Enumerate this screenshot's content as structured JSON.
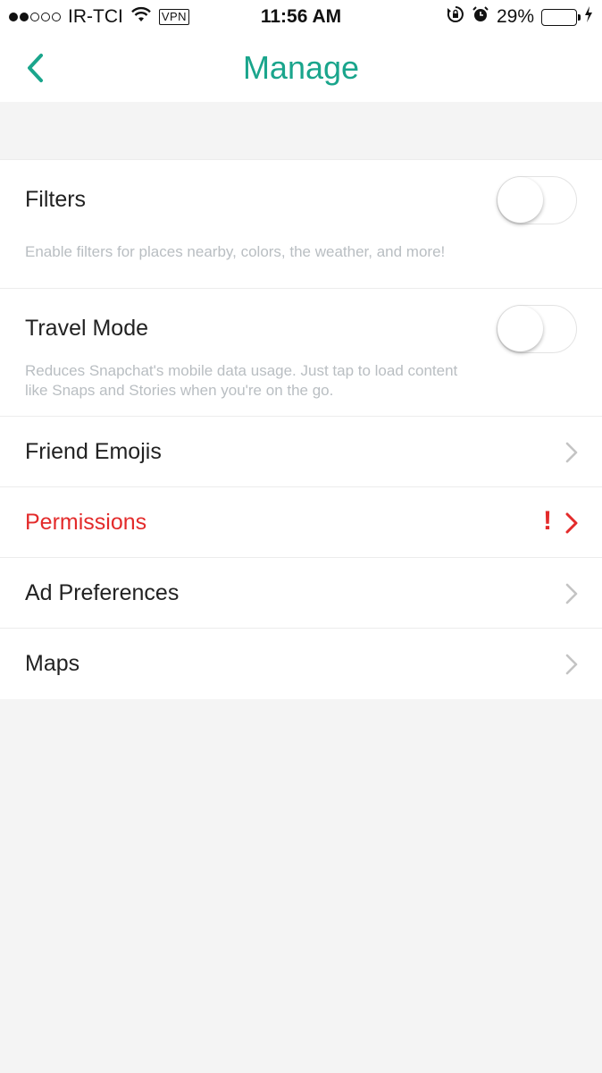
{
  "status_bar": {
    "carrier": "IR-TCI",
    "vpn": "VPN",
    "time": "11:56 AM",
    "battery_percent": "29%",
    "battery_level": 0.29,
    "icons": [
      "signal-icon",
      "wifi-icon",
      "rotation-lock-icon",
      "alarm-icon",
      "battery-icon",
      "charging-icon"
    ]
  },
  "header": {
    "title": "Manage",
    "back_icon": "chevron-left-icon"
  },
  "colors": {
    "accent": "#1aa58c",
    "alert": "#e32b2b",
    "description": "#b9bec2",
    "background": "#f4f4f4"
  },
  "settings": {
    "filters": {
      "label": "Filters",
      "description": "Enable filters for places nearby, colors, the weather, and more!",
      "enabled": false
    },
    "travel_mode": {
      "label": "Travel Mode",
      "description_line1": "Reduces Snapchat's mobile data usage. Just tap to load content",
      "description_line2": "like Snaps and Stories when you're on the go.",
      "enabled": false
    },
    "links": [
      {
        "label": "Friend Emojis"
      },
      {
        "label": "Permissions",
        "alert": true,
        "alert_symbol": "!"
      },
      {
        "label": "Ad Preferences"
      },
      {
        "label": "Maps"
      }
    ]
  }
}
